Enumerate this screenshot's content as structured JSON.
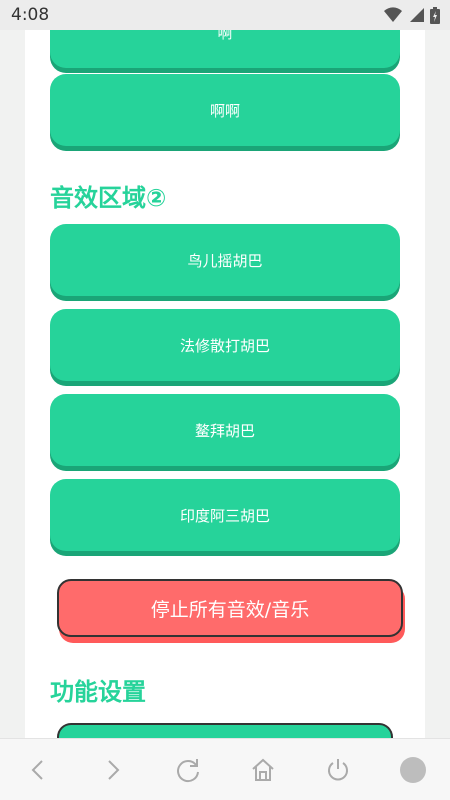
{
  "status_bar": {
    "time": "4:08",
    "icons": [
      "wifi-icon",
      "signal-icon",
      "battery-icon"
    ]
  },
  "sound_buttons_section1": [
    {
      "label": "啊"
    },
    {
      "label": "啊啊"
    }
  ],
  "section2": {
    "title": "音效区域②",
    "buttons": [
      {
        "label": "鸟儿摇胡巴"
      },
      {
        "label": "法修散打胡巴"
      },
      {
        "label": "鳌拜胡巴"
      },
      {
        "label": "印度阿三胡巴"
      }
    ]
  },
  "stop_button": {
    "label": "停止所有音效/音乐"
  },
  "settings": {
    "title": "功能设置"
  },
  "colors": {
    "accent": "#26d39a",
    "stop": "#ff6b6b"
  },
  "navbar": {
    "icons": [
      "back-icon",
      "forward-icon",
      "reload-icon",
      "home-icon",
      "power-icon",
      "record-icon"
    ]
  }
}
